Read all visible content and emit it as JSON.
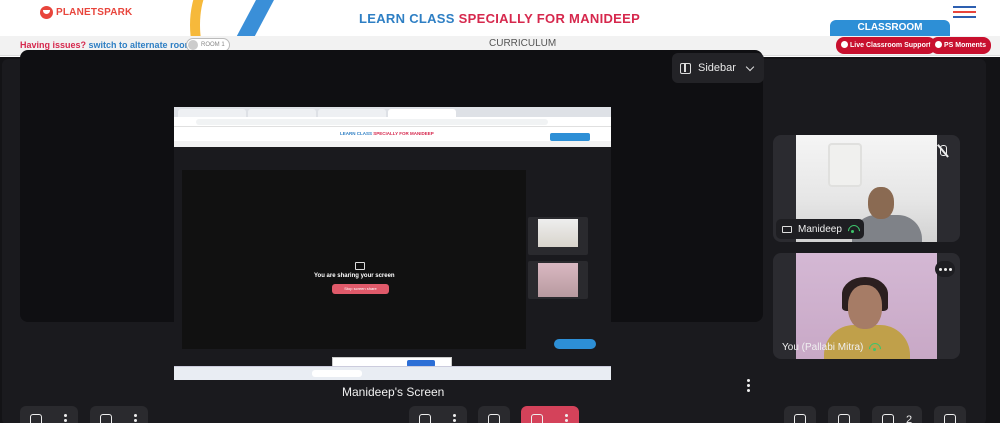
{
  "header": {
    "logo_text": "PLANETSPARK",
    "title_prefix": "LEARN CLASS ",
    "title_highlight": "SPECIALLY FOR MANIDEEP",
    "classroom_tab": "CLASSROOM"
  },
  "subbar": {
    "issues_text": "Having issues?",
    "switch_link": "switch to alternate room",
    "room_toggle": "ROOM 1",
    "curriculum": "CURRICULUM",
    "live_support": "Live Classroom Support",
    "ps_moments": "PS Moments"
  },
  "meeting": {
    "sidebar_label": "Sidebar",
    "screen_label": "Manideep's Screen",
    "shared_screen": {
      "sharing_text": "You are sharing your screen",
      "stop_label": "Stop screen share"
    },
    "participants": [
      {
        "name": "Manideep"
      },
      {
        "name": "You (Pallabi Mitra)"
      }
    ],
    "people_count": "2"
  },
  "colors": {
    "brand_red": "#d6284d",
    "brand_blue": "#2e7fc4",
    "leave_red": "#d4425a",
    "stage_bg": "#131316"
  }
}
